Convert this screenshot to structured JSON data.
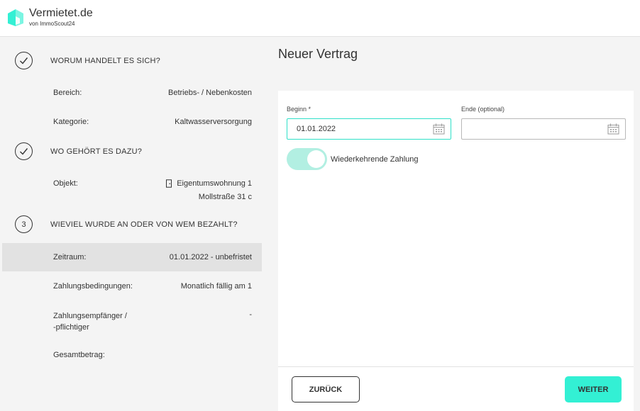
{
  "brand": {
    "name": "Vermietet.de",
    "sub": "von ImmoScout24",
    "accent": "#33f0d4"
  },
  "sidebar": {
    "step1": {
      "title": "WORUM HANDELT ES SICH?",
      "state": "done"
    },
    "bereich": {
      "label": "Bereich:",
      "value": "Betriebs- / Nebenkosten"
    },
    "kategorie": {
      "label": "Kategorie:",
      "value": "Kaltwasserversorgung"
    },
    "step2": {
      "title": "WO GEHÖRT ES DAZU?",
      "state": "done"
    },
    "objekt": {
      "label": "Objekt:",
      "value_line1": "Eigentumswohnung 1",
      "value_line2": "Mollstraße 31 c"
    },
    "step3": {
      "number": "3",
      "title": "WIEVIEL WURDE AN ODER VON WEM BEZAHLT?"
    },
    "zeitraum": {
      "label": "Zeitraum:",
      "value": "01.01.2022 - unbefristet"
    },
    "zahlungsbedingungen": {
      "label": "Zahlungsbedingungen:",
      "value": "Monatlich fällig am 1"
    },
    "zahlungsempfaenger": {
      "label_line1": "Zahlungsempfänger /",
      "label_line2": "-pflichtiger",
      "value": "-"
    },
    "gesamtbetrag": {
      "label": "Gesamtbetrag:",
      "value": ""
    }
  },
  "main": {
    "title": "Neuer Vertrag",
    "beginn": {
      "label": "Beginn *",
      "value": "01.01.2022"
    },
    "ende": {
      "label": "Ende (optional)",
      "value": ""
    },
    "toggle": {
      "label": "Wiederkehrende Zahlung",
      "checked": true
    },
    "back_label": "ZURÜCK",
    "next_label": "WEITER"
  }
}
